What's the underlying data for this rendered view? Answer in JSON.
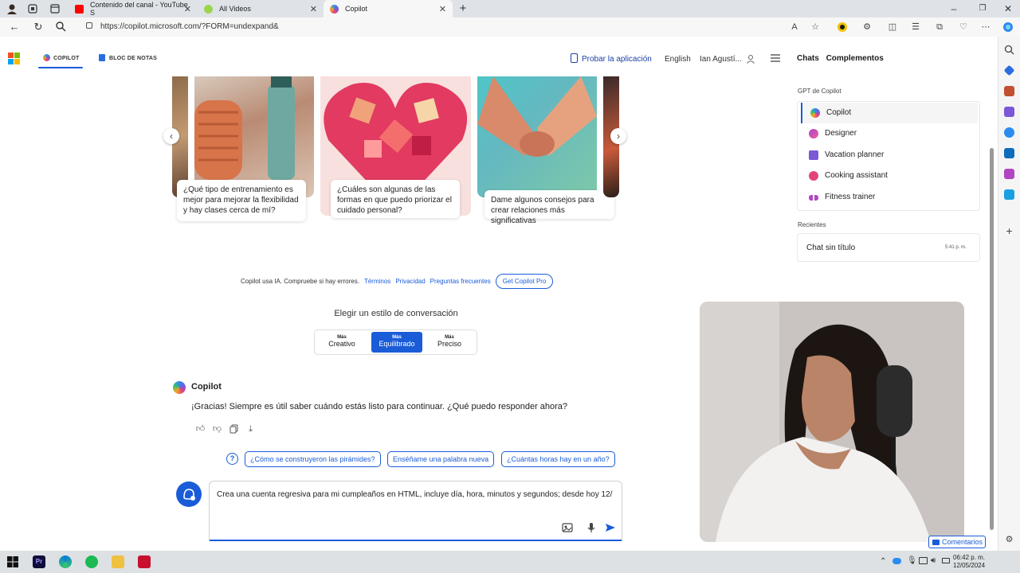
{
  "browser": {
    "tabs": [
      {
        "title": "Contenido del canal - YouTube S",
        "color": "#ff0000"
      },
      {
        "title": "All Videos",
        "color": "#9bd44f"
      },
      {
        "title": "Copilot",
        "color": "#7a58d6"
      }
    ],
    "url": "https://copilot.microsoft.com/?FORM=undexpand&"
  },
  "header": {
    "tab_copilot": "COPILOT",
    "tab_notebook": "BLOC DE NOTAS",
    "try_app": "Probar la aplicación",
    "language": "English",
    "user": "Ian Agustí..."
  },
  "carousel": [
    {
      "text": "¿Qué tipo de entrenamiento es mejor para mejorar la flexibilidad y hay clases cerca de mí?"
    },
    {
      "text": "¿Cuáles son algunas de las formas en que puedo priorizar el cuidado personal?"
    },
    {
      "text": "Dame algunos consejos para crear relaciones más significativas"
    }
  ],
  "disclaimer": {
    "text": "Copilot usa IA. Compruebe si hay errores.",
    "links": [
      "Términos",
      "Privacidad",
      "Preguntas frecuentes"
    ],
    "pro": "Get Copilot Pro"
  },
  "style_picker": {
    "title": "Elegir un estilo de conversación",
    "options": [
      {
        "top": "Más",
        "label": "Creativo"
      },
      {
        "top": "Más",
        "label": "Equilibrado"
      },
      {
        "top": "Más",
        "label": "Preciso"
      }
    ],
    "selected": 1
  },
  "message": {
    "author": "Copilot",
    "text": "¡Gracias! Siempre es útil saber cuándo estás listo para continuar. ¿Qué puedo responder ahora?"
  },
  "suggestions": [
    "¿Cómo se construyeron las pirámides?",
    "Enséñame una palabra nueva",
    "¿Cuántas horas hay en un año?"
  ],
  "composer": {
    "text": "Crea una cuenta regresiva para mi cumpleaños en HTML, incluye día, hora, minutos y segundos; desde hoy 12/"
  },
  "right_panel": {
    "tabs": [
      "Chats",
      "Complementos"
    ],
    "gpt_heading": "GPT de Copilot",
    "gpts": [
      "Copilot",
      "Designer",
      "Vacation planner",
      "Cooking assistant",
      "Fitness trainer"
    ],
    "recent_heading": "Recientes",
    "recent": [
      {
        "title": "Chat sin título",
        "time": "5:41 p. m."
      }
    ],
    "feedback": "Comentarios"
  },
  "taskbar": {
    "time": "06:42 p. m.",
    "date": "12/05/2024"
  },
  "colors": {
    "accent": "#1a5cd8"
  }
}
